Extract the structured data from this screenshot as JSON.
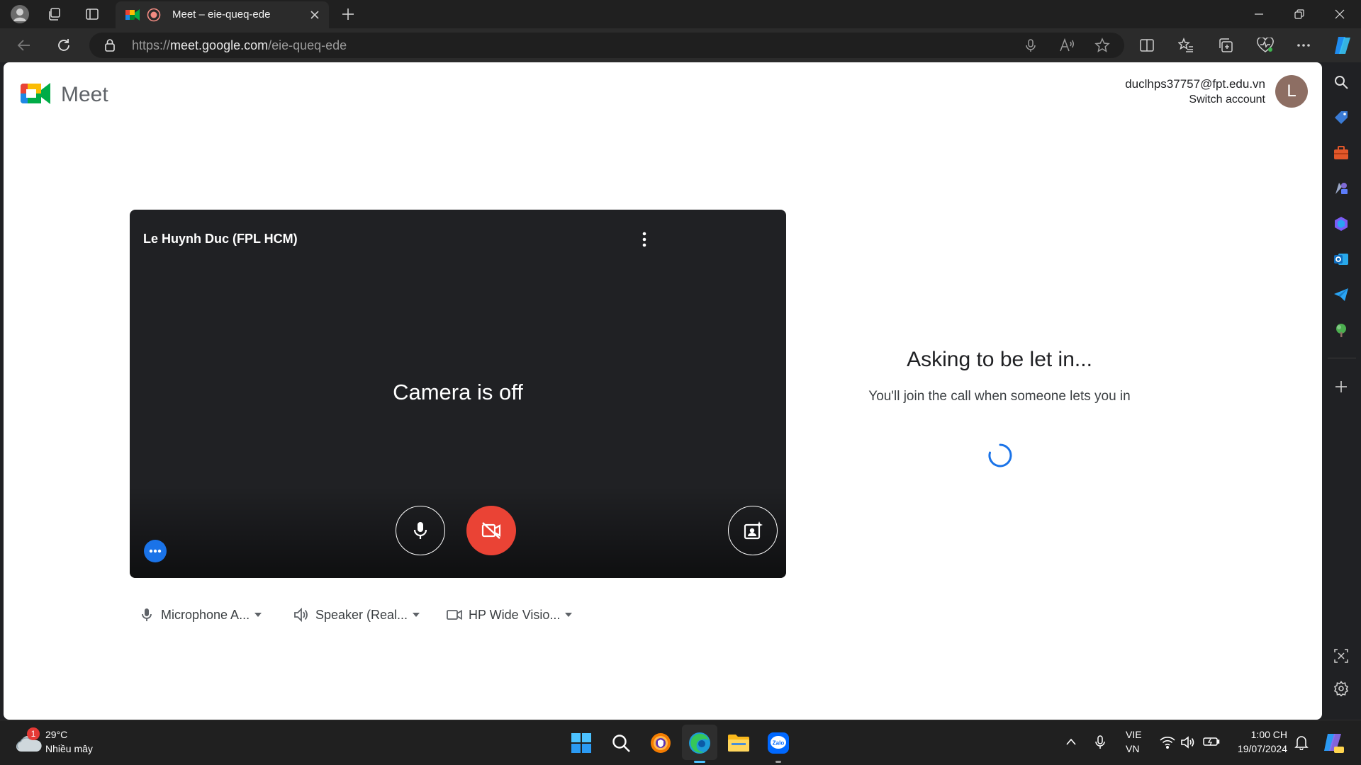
{
  "browser": {
    "tab_title": "Meet – eie-queq-ede",
    "url_prefix": "https://",
    "url_host": "meet.google.com",
    "url_path": "/eie-queq-ede"
  },
  "meet": {
    "product_name": "Meet",
    "account_email": "duclhps37757@fpt.edu.vn",
    "switch_account": "Switch account",
    "avatar_letter": "L"
  },
  "preview": {
    "participant_name": "Le Huynh Duc (FPL HCM)",
    "camera_status": "Camera is off"
  },
  "devices": {
    "microphone": "Microphone A...",
    "speaker": "Speaker (Real...",
    "camera": "HP Wide Visio..."
  },
  "waiting": {
    "title": "Asking to be let in...",
    "subtitle": "You'll join the call when someone lets you in"
  },
  "taskbar": {
    "weather_temp": "29°C",
    "weather_desc": "Nhiều mây",
    "weather_badge": "1",
    "lang_top": "VIE",
    "lang_bottom": "VN",
    "time": "1:00 CH",
    "date": "19/07/2024"
  },
  "colors": {
    "end_red": "#ea4335",
    "accent_blue": "#1a73e8",
    "avatar_brown": "#8d6e63"
  }
}
